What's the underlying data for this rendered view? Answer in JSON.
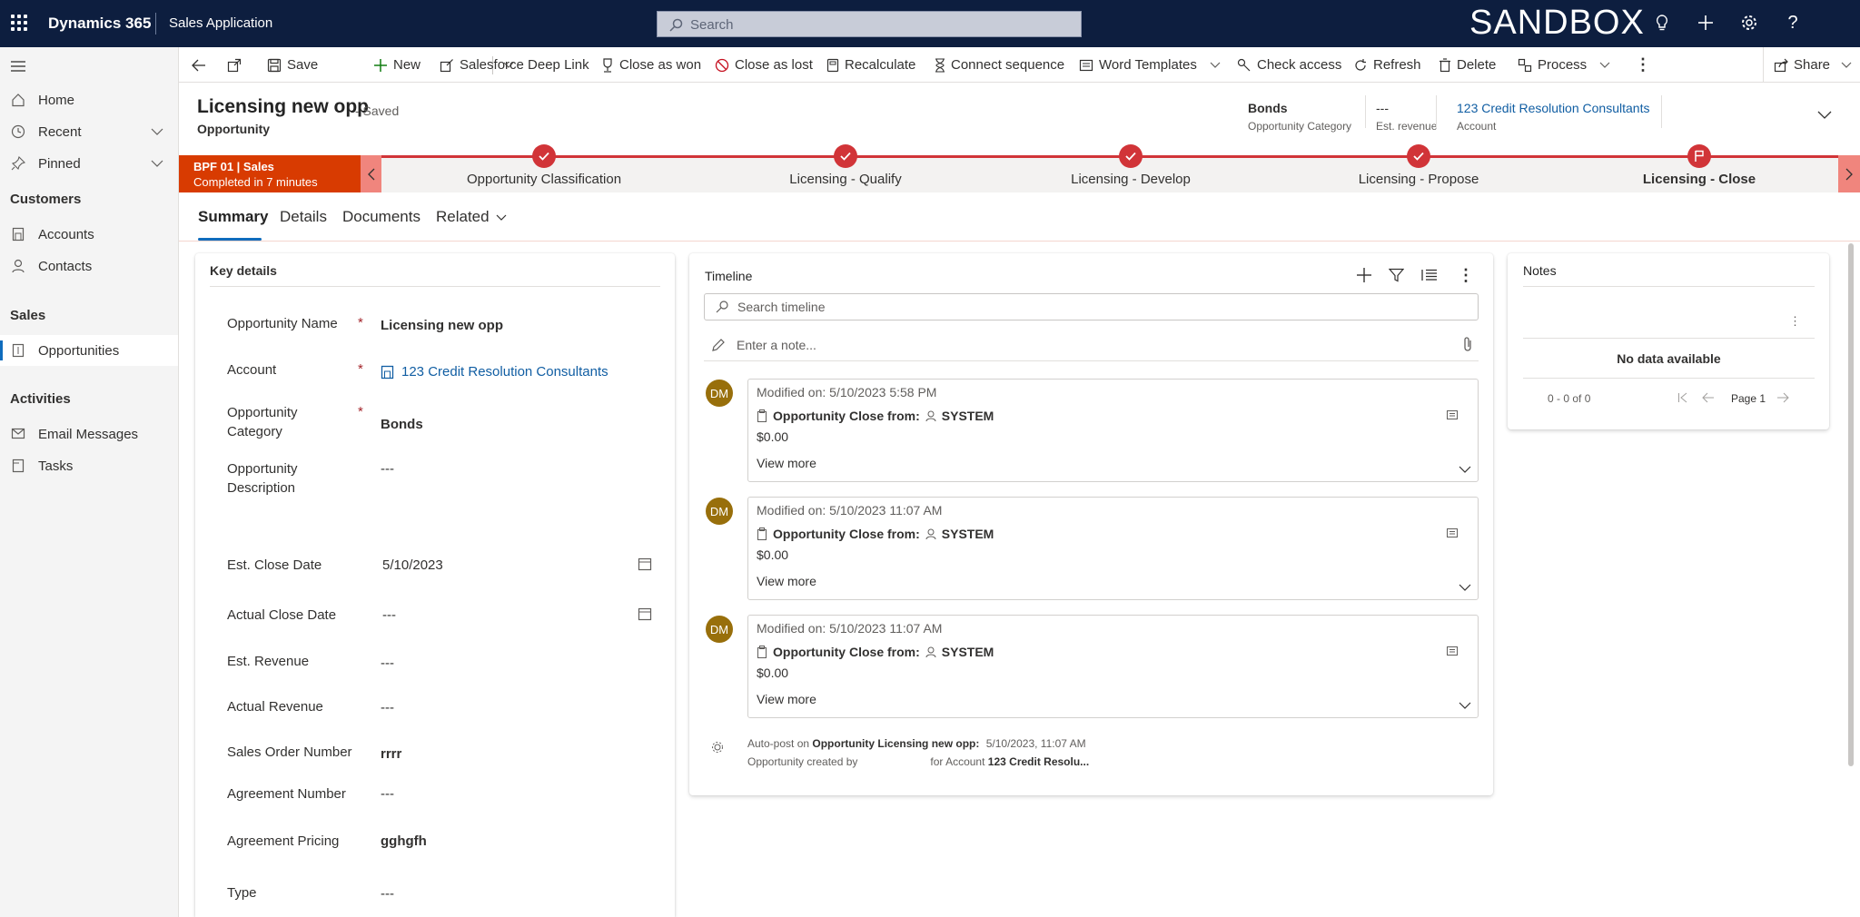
{
  "topbar": {
    "brand": "Dynamics 365",
    "app_name": "Sales Application",
    "search_placeholder": "Search",
    "env_label": "SANDBOX"
  },
  "commands": {
    "save": "Save",
    "new": "New",
    "sf_link": "Salesforce Deep Link",
    "close_won": "Close as won",
    "close_lost": "Close as lost",
    "recalculate": "Recalculate",
    "connect_sequence": "Connect sequence",
    "word_templates": "Word Templates",
    "check_access": "Check access",
    "refresh": "Refresh",
    "delete": "Delete",
    "process": "Process",
    "share": "Share"
  },
  "nav": {
    "home": "Home",
    "recent": "Recent",
    "pinned": "Pinned",
    "customers_head": "Customers",
    "accounts": "Accounts",
    "contacts": "Contacts",
    "sales_head": "Sales",
    "opportunities": "Opportunities",
    "activities_head": "Activities",
    "email_messages": "Email Messages",
    "tasks": "Tasks"
  },
  "header": {
    "title": "Licensing new opp",
    "saved": "- Saved",
    "entity": "Opportunity",
    "fields": [
      {
        "value": "Bonds",
        "label": "Opportunity Category"
      },
      {
        "value": "---",
        "label": "Est. revenue"
      },
      {
        "value": "123 Credit Resolution Consultants",
        "label": "Account"
      }
    ]
  },
  "bpf": {
    "name": "BPF 01 | Sales",
    "status": "Completed in 7 minutes",
    "stages": [
      "Opportunity Classification",
      "Licensing - Qualify",
      "Licensing - Develop",
      "Licensing - Propose",
      "Licensing - Close"
    ]
  },
  "tabs": [
    "Summary",
    "Details",
    "Documents",
    "Related"
  ],
  "key_details": {
    "title": "Key details",
    "name_label": "Opportunity Name",
    "name_value": "Licensing new opp",
    "account_label": "Account",
    "account_value": "123 Credit Resolution Consultants",
    "category_label_1": "Opportunity",
    "category_label_2": "Category",
    "category_value": "Bonds",
    "desc_label_1": "Opportunity",
    "desc_label_2": "Description",
    "desc_value": "---",
    "close_date_label": "Est. Close Date",
    "close_date_value": "5/10/2023",
    "actual_close_label": "Actual Close Date",
    "actual_close_value": "---",
    "est_rev_label": "Est. Revenue",
    "est_rev_value": "---",
    "actual_rev_label": "Actual Revenue",
    "actual_rev_value": "---",
    "son_label": "Sales Order Number",
    "son_value": "rrrr",
    "agr_num_label": "Agreement Number",
    "agr_num_value": "---",
    "agr_price_label": "Agreement Pricing",
    "agr_price_value": "gghgfh",
    "type_label": "Type",
    "type_value": "---"
  },
  "timeline": {
    "title": "Timeline",
    "search_placeholder": "Search timeline",
    "note_placeholder": "Enter a note...",
    "entries": [
      {
        "avatar": "DM",
        "modified": "Modified on: 5/10/2023 5:58 PM",
        "title": "Opportunity Close from:",
        "user": "SYSTEM",
        "amount": "$0.00",
        "more": "View more"
      },
      {
        "avatar": "DM",
        "modified": "Modified on: 5/10/2023 11:07 AM",
        "title": "Opportunity Close from:",
        "user": "SYSTEM",
        "amount": "$0.00",
        "more": "View more"
      },
      {
        "avatar": "DM",
        "modified": "Modified on: 5/10/2023 11:07 AM",
        "title": "Opportunity Close from:",
        "user": "SYSTEM",
        "amount": "$0.00",
        "more": "View more"
      }
    ],
    "autopost": {
      "prefix": "Auto-post on",
      "target": "Opportunity Licensing new opp:",
      "time": "5/10/2023, 11:07 AM",
      "line2_a": "Opportunity created by",
      "line2_b": "for Account",
      "line2_c": "123 Credit Resolu..."
    }
  },
  "notes": {
    "title": "Notes",
    "empty": "No data available",
    "count": "0 - 0 of 0",
    "page": "Page 1"
  }
}
